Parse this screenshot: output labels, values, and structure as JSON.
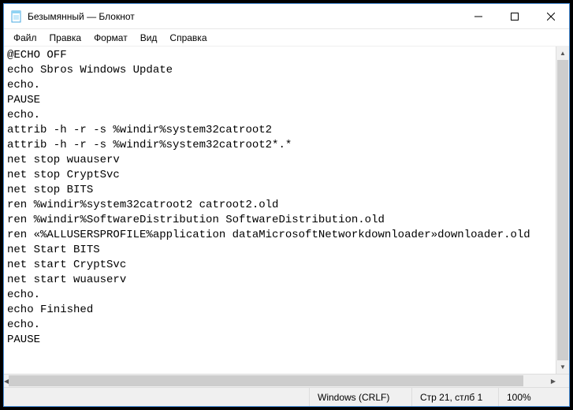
{
  "titlebar": {
    "title": "Безымянный — Блокнот"
  },
  "menu": {
    "file": "Файл",
    "edit": "Правка",
    "format": "Формат",
    "view": "Вид",
    "help": "Справка"
  },
  "editor": {
    "content": "@ECHO OFF\necho Sbros Windows Update\necho.\nPAUSE\necho.\nattrib -h -r -s %windir%system32catroot2\nattrib -h -r -s %windir%system32catroot2*.*\nnet stop wuauserv\nnet stop CryptSvc\nnet stop BITS\nren %windir%system32catroot2 catroot2.old\nren %windir%SoftwareDistribution SoftwareDistribution.old\nren «%ALLUSERSPROFILE%application dataMicrosoftNetworkdownloader»downloader.old\nnet Start BITS\nnet start CryptSvc\nnet start wuauserv\necho.\necho Finished\necho.\nPAUSE"
  },
  "status": {
    "encoding_nl": "Windows (CRLF)",
    "position": "Стр 21, стлб 1",
    "zoom": "100%"
  }
}
